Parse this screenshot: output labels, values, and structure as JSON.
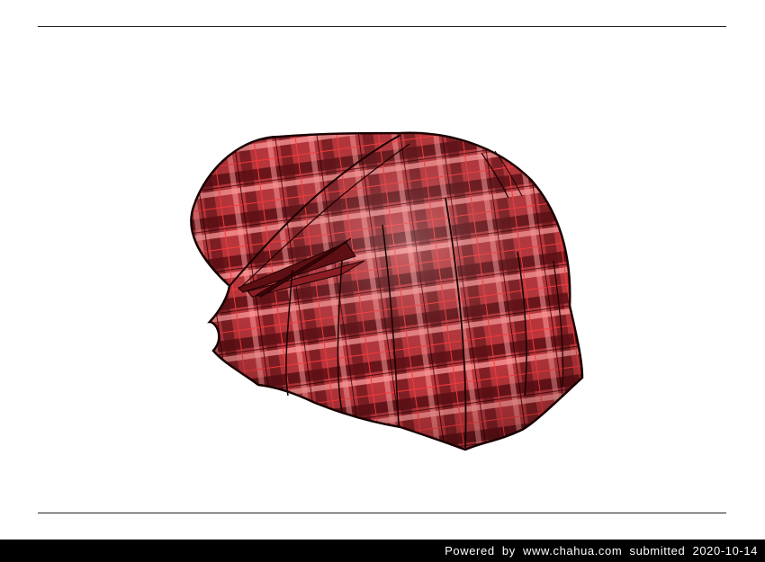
{
  "footer": {
    "powered_label": "Powered by",
    "site": "www.chahua.com",
    "submitted_label": "submitted",
    "date": "2020-10-14"
  },
  "artwork": {
    "subject": "plaid-cloth-illustration",
    "colors": {
      "base": "#b8363c",
      "dark": "#5e0f14",
      "light": "#ff9a9a",
      "line": "#ff3a3a",
      "outline": "#1a0000"
    }
  }
}
